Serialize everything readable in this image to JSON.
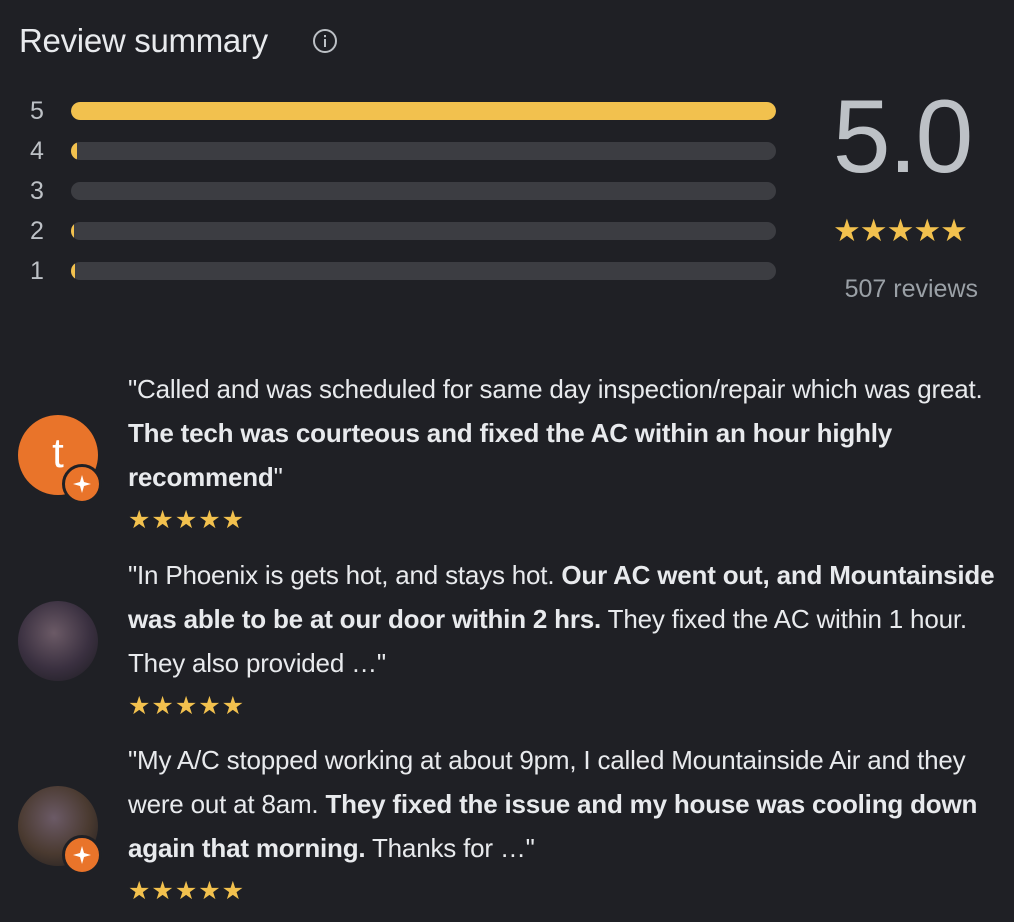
{
  "summary": {
    "title": "Review summary",
    "info_icon": "info-icon",
    "rating": "5.0",
    "stars": "★★★★★",
    "review_count": "507 reviews",
    "distribution": [
      {
        "stars": "5",
        "fraction": 1.0
      },
      {
        "stars": "4",
        "fraction": 0.008
      },
      {
        "stars": "3",
        "fraction": 0.0
      },
      {
        "stars": "2",
        "fraction": 0.003
      },
      {
        "stars": "1",
        "fraction": 0.005
      }
    ]
  },
  "colors": {
    "background": "#1f2025",
    "star": "#f2c14e",
    "bar_track": "#3c3d42",
    "badge": "#e9742a"
  },
  "reviews": [
    {
      "avatar": "letter-avatar",
      "avatar_letter": "t",
      "avatar_color": "#e9742a",
      "parts": [
        {
          "text": "\"Called and was scheduled for same day inspection/repair which was great. ",
          "bold": false
        },
        {
          "text": "The tech was courteous and fixed the AC within an hour highly recommend",
          "bold": true
        },
        {
          "text": "\"",
          "bold": false
        }
      ],
      "stars": "★★★★★"
    },
    {
      "avatar": "photo-avatar",
      "avatar_letter": "",
      "avatar_color": "#3a3040",
      "parts": [
        {
          "text": "\"In Phoenix is gets hot, and stays hot. ",
          "bold": false
        },
        {
          "text": "Our AC went out, and Mountainside was able to be at our door within 2 hrs.",
          "bold": true
        },
        {
          "text": " They fixed the AC within 1 hour. They also provided …\"",
          "bold": false
        }
      ],
      "stars": "★★★★★"
    },
    {
      "avatar": "photo-avatar",
      "avatar_letter": "",
      "avatar_color": "#4a3a30",
      "parts": [
        {
          "text": "\"My A/C stopped working at about 9pm, I called Mountainside Air and they were out at 8am. ",
          "bold": false
        },
        {
          "text": "They fixed the issue and my house was cooling down again that morning.",
          "bold": true
        },
        {
          "text": " Thanks for …\"",
          "bold": false
        }
      ],
      "stars": "★★★★★"
    }
  ]
}
